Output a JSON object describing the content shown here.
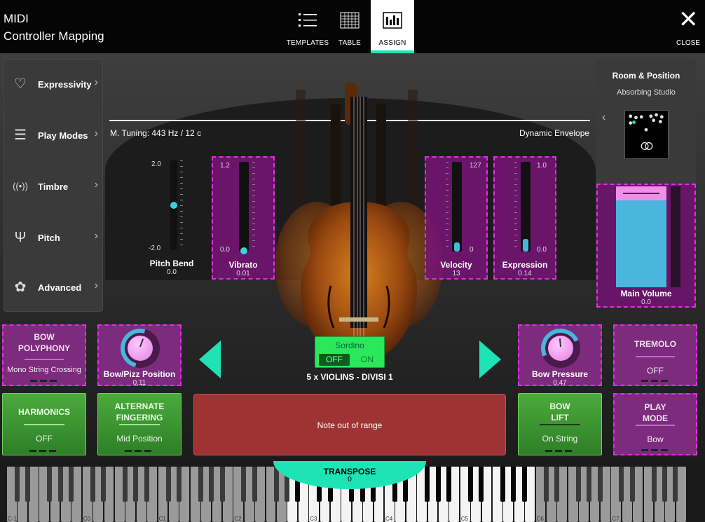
{
  "app": {
    "title_line1": "MIDI",
    "title_line2": "Controller Mapping"
  },
  "nav": {
    "tabs": [
      {
        "label": "TEMPLATES",
        "icon": "list-icon"
      },
      {
        "label": "TABLE",
        "icon": "table-icon"
      },
      {
        "label": "ASSIGN",
        "icon": "assign-icon",
        "active": true
      }
    ],
    "close_label": "CLOSE"
  },
  "sidebar": {
    "items": [
      {
        "label": "Expressivity",
        "icon": "heart-icon"
      },
      {
        "label": "Play Modes",
        "icon": "sliders-icon"
      },
      {
        "label": "Timbre",
        "icon": "waves-icon"
      },
      {
        "label": "Pitch",
        "icon": "tuning-fork-icon"
      },
      {
        "label": "Advanced",
        "icon": "advanced-icon"
      }
    ]
  },
  "header": {
    "tuning": "M. Tuning: 443 Hz / 12 c",
    "envelope": "Dynamic Envelope"
  },
  "faders": {
    "pitch_bend": {
      "name": "Pitch Bend",
      "value": "0.0",
      "max": "2.0",
      "min": "-2.0",
      "level": 0.5
    },
    "vibrato": {
      "name": "Vibrato",
      "value": "0.01",
      "max": "1.2",
      "min": "0.0",
      "level": 0.01
    },
    "velocity": {
      "name": "Velocity",
      "value": "13",
      "max": "127",
      "min": "0",
      "level": 0.1
    },
    "expression": {
      "name": "Expression",
      "value": "0.14",
      "max": "1.0",
      "min": "0.0",
      "level": 0.14
    }
  },
  "room": {
    "title": "Room & Position",
    "subtitle": "Absorbing Studio"
  },
  "main_volume": {
    "name": "Main Volume",
    "value": "0.0"
  },
  "tiles": {
    "bow_polyphony": {
      "title_line1": "BOW",
      "title_line2": "POLYPHONY",
      "value": "Mono String Crossing"
    },
    "bow_pizz": {
      "name": "Bow/Pizz Position",
      "value": "0.11"
    },
    "bow_pressure": {
      "name": "Bow Pressure",
      "value": "0.47"
    },
    "tremolo": {
      "title": "TREMOLO",
      "value": "OFF"
    },
    "harmonics": {
      "title": "HARMONICS",
      "value": "OFF"
    },
    "alt_fingering": {
      "title_line1": "ALTERNATE",
      "title_line2": "FINGERING",
      "value": "Mid Position"
    },
    "bow_lift": {
      "title_line1": "BOW",
      "title_line2": "LIFT",
      "value": "On String"
    },
    "play_mode": {
      "title_line1": "PLAY",
      "title_line2": "MODE",
      "value": "Bow"
    }
  },
  "sordino": {
    "title": "Sordino",
    "off": "OFF",
    "on": "ON"
  },
  "instrument": "5 x VIOLINS - DIVISI 1",
  "message": "Note out of range",
  "transpose": {
    "name": "TRANSPOSE",
    "value": "0"
  },
  "keyboard": {
    "octaves": [
      "C-1",
      "C0",
      "C1",
      "C2",
      "C3",
      "C4",
      "C5",
      "C6",
      "C7"
    ]
  },
  "colors": {
    "accent": "#1ee3b4",
    "assign_border": "#e62ee6",
    "fader_fill": "#49b6dd"
  }
}
